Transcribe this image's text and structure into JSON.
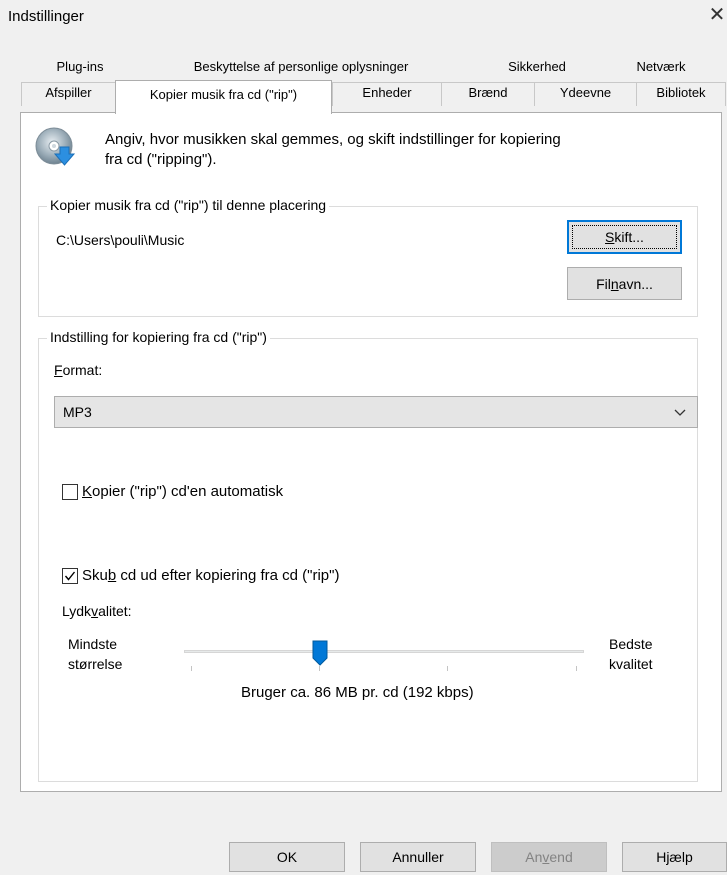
{
  "window": {
    "title": "Indstillinger",
    "close_glyph": "✕"
  },
  "tabs": {
    "top_row": [
      "Plug-ins",
      "Beskyttelse af personlige oplysninger",
      "Sikkerhed",
      "Netværk"
    ],
    "bottom_row": [
      "Afspiller",
      "Kopier musik fra cd (\"rip\")",
      "Enheder",
      "Brænd",
      "Ydeevne",
      "Bibliotek"
    ],
    "active": "Kopier musik fra cd (\"rip\")"
  },
  "header": {
    "icon": "cd-rip-icon",
    "description_line1": "Angiv, hvor musikken skal gemmes, og skift indstillinger for kopiering",
    "description_line2": "fra cd (\"ripping\")."
  },
  "location_group": {
    "label": "Kopier musik fra cd (\"rip\") til denne placering",
    "path": "C:\\Users\\pouli\\Music",
    "change_button": {
      "underlined": "S",
      "rest": "kift..."
    },
    "filename_button": {
      "before": "Fil",
      "underlined": "n",
      "after": "avn..."
    }
  },
  "settings_group": {
    "label": "Indstilling for kopiering fra cd (\"rip\")",
    "format_label": {
      "underlined": "F",
      "rest": "ormat:"
    },
    "format_value": "MP3",
    "auto_rip": {
      "checked": false,
      "underlined": "K",
      "rest": "opier (\"rip\") cd'en automatisk"
    },
    "eject": {
      "checked": true,
      "before": "Sku",
      "underlined": "b",
      "after": " cd ud efter kopiering fra cd (\"rip\")"
    },
    "quality_label": {
      "before": "Lydk",
      "underlined": "v",
      "after": "alitet:"
    },
    "quality_min_line1": "Mindste",
    "quality_min_line2": "størrelse",
    "quality_max_line1": "Bedste",
    "quality_max_line2": "kvalitet",
    "quality_level_fraction": 0.34,
    "quality_summary": "Bruger ca. 86 MB pr. cd (192 kbps)"
  },
  "footer": {
    "ok": "OK",
    "cancel": "Annuller",
    "apply": {
      "before": "An",
      "underlined": "v",
      "after": "end"
    },
    "help": "Hjælp"
  },
  "colors": {
    "accent": "#0078d7",
    "panel_bg": "#ffffff",
    "window_bg": "#f0f0f0"
  }
}
